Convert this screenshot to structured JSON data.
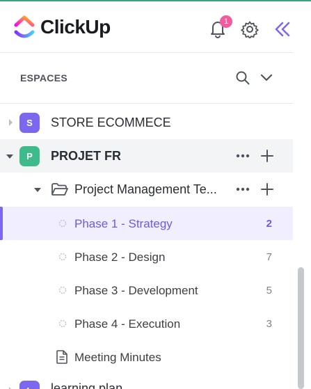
{
  "app": {
    "name": "ClickUp"
  },
  "header": {
    "notification_count": "1",
    "colors": {
      "badge": "#f25ba0",
      "collapse": "#7b68ee"
    }
  },
  "sidebar": {
    "section_title": "ESPACES",
    "spaces": [
      {
        "initial": "S",
        "name": "STORE ECOMMECE",
        "color": "#7b68ee",
        "expanded": false
      },
      {
        "initial": "P",
        "name": "PROJET FR",
        "color": "#3dbb8b",
        "expanded": true
      },
      {
        "initial": "L",
        "name": "learning plan",
        "color": "#7b68ee",
        "expanded": false
      }
    ],
    "folder": {
      "name": "Project Management Te..."
    },
    "lists": [
      {
        "name": "Phase 1 - Strategy",
        "count": "2",
        "active": true
      },
      {
        "name": "Phase 2 - Design",
        "count": "7",
        "active": false
      },
      {
        "name": "Phase 3 - Development",
        "count": "5",
        "active": false
      },
      {
        "name": "Phase 4 - Execution",
        "count": "3",
        "active": false
      }
    ],
    "doc": {
      "name": "Meeting Minutes"
    }
  },
  "colors": {
    "accent": "#7b68ee",
    "active_bg": "#f1efff"
  }
}
